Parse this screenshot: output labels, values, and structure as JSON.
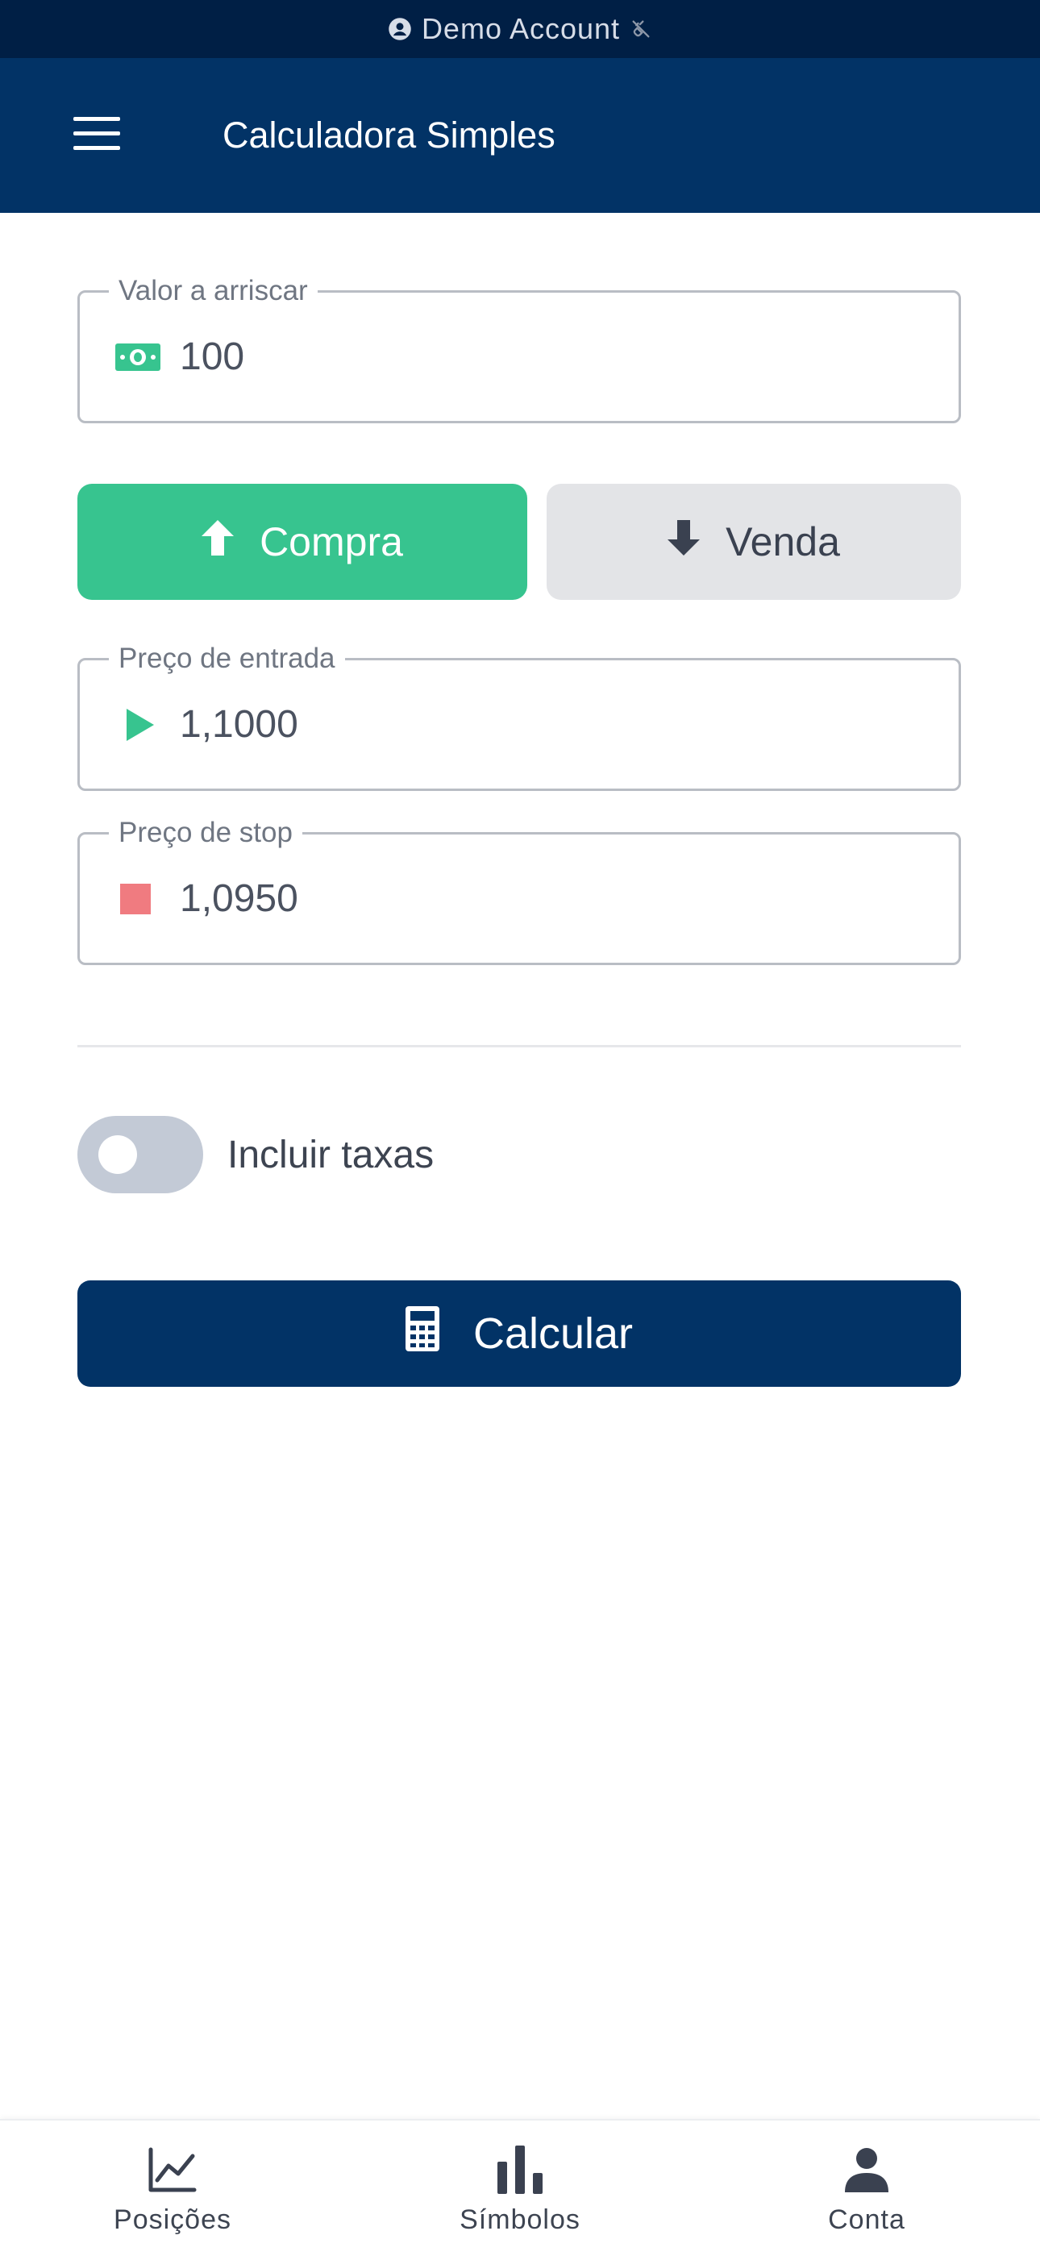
{
  "status_bar": {
    "account_label": "Demo Account",
    "account_icon": "user-circle-icon",
    "connection_icon": "disconnected-plug-icon"
  },
  "header": {
    "title": "Calculadora Simples",
    "menu_icon": "hamburger-menu-icon"
  },
  "form": {
    "risk": {
      "label": "Valor a arriscar",
      "value": "100",
      "icon": "money-bill-icon"
    },
    "side": {
      "buy_label": "Compra",
      "sell_label": "Venda",
      "selected": "buy"
    },
    "entry": {
      "label": "Preço de entrada",
      "value": "1,1000",
      "icon": "play-triangle-icon"
    },
    "stop": {
      "label": "Preço de stop",
      "value": "1,0950",
      "icon": "stop-square-icon"
    },
    "fees_toggle": {
      "label": "Incluir taxas",
      "on": false
    },
    "calculate_label": "Calcular"
  },
  "bottom_nav": {
    "items": [
      {
        "label": "Posições",
        "icon": "line-chart-icon"
      },
      {
        "label": "Símbolos",
        "icon": "bar-chart-icon"
      },
      {
        "label": "Conta",
        "icon": "person-icon"
      }
    ]
  },
  "colors": {
    "primary": "#023366",
    "status_bar": "#001f45",
    "buy_green": "#37c48f",
    "stop_red": "#f07b80",
    "sell_gray": "#e3e4e7",
    "toggle_off": "#c3cad6"
  }
}
